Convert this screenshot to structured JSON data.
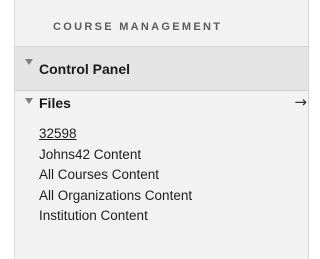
{
  "section": {
    "title": "COURSE MANAGEMENT"
  },
  "control_panel": {
    "label": "Control Panel",
    "icon": "triangle-down-icon"
  },
  "files": {
    "label": "Files",
    "icon": "triangle-down-icon",
    "arrow": "→",
    "items": [
      {
        "label": "32598",
        "underlined": true
      },
      {
        "label": "Johns42 Content"
      },
      {
        "label": "All Courses Content"
      },
      {
        "label": "All Organizations Content"
      },
      {
        "label": "Institution Content"
      }
    ]
  }
}
